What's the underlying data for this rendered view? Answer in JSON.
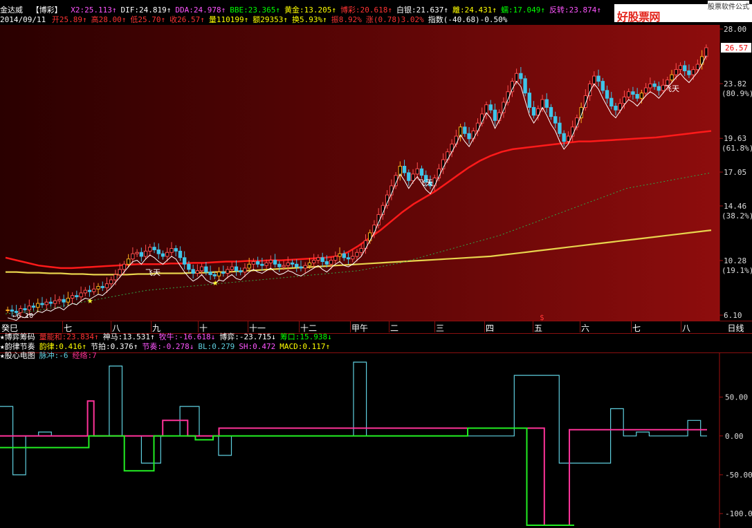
{
  "header": {
    "stock_name": "金达威",
    "indicator_tag": "【博彩】",
    "items": [
      {
        "text": "X2:25.113↑",
        "color": "#ff55ff"
      },
      {
        "text": "DIF:24.819↑",
        "color": "#ffffff"
      },
      {
        "text": "DDA:24.978↑",
        "color": "#ff55ff"
      },
      {
        "text": "BBE:23.365↑",
        "color": "#00ff00"
      },
      {
        "text": "黄金:13.205↑",
        "color": "#ffff00"
      },
      {
        "text": "博彩:20.618↑",
        "color": "#ff3333"
      },
      {
        "text": "白银:21.637↑",
        "color": "#ffffff"
      },
      {
        "text": "離:24.431↑",
        "color": "#ffff00"
      },
      {
        "text": "蠕:17.049↑",
        "color": "#00ff00"
      },
      {
        "text": "反转:23.874↑",
        "color": "#ff55ff"
      }
    ]
  },
  "quote": {
    "date": "2014/09/11",
    "items": [
      {
        "text": "开25.89↑",
        "color": "#ff3333"
      },
      {
        "text": "高28.00↑",
        "color": "#ff3333"
      },
      {
        "text": "低25.70↑",
        "color": "#ff3333"
      },
      {
        "text": "收26.57↑",
        "color": "#ff3333"
      },
      {
        "text": "量110199↑",
        "color": "#ffff00"
      },
      {
        "text": "额29353↑",
        "color": "#ffff00"
      },
      {
        "text": "换5.93%↑",
        "color": "#ffff00"
      },
      {
        "text": "振8.92%",
        "color": "#ff3333"
      },
      {
        "text": "涨(0.78)3.02%",
        "color": "#ff3333"
      },
      {
        "text": "指数(-40.68)-0.50%",
        "color": "#ffffff"
      }
    ]
  },
  "watermark": {
    "text": "好股票网Goodgupiao.com",
    "sub": "股票软件公式"
  },
  "chart_data": [
    {
      "type": "line",
      "name": "candlestick-price",
      "y_ticks": [
        {
          "value": 28.0,
          "label": "28.00"
        },
        {
          "value": 23.82,
          "label": "23.82",
          "pct": "(80.9%)"
        },
        {
          "value": 19.63,
          "label": "19.63",
          "pct": "(61.8%)"
        },
        {
          "value": 17.05,
          "label": "17.05"
        },
        {
          "value": 14.46,
          "label": "14.46",
          "pct": "(38.2%)"
        },
        {
          "value": 10.28,
          "label": "10.28",
          "pct": "(19.1%)"
        },
        {
          "value": 6.1,
          "label": "6.10"
        }
      ],
      "last_price": "26.57",
      "low_label": "6.10",
      "ylim": [
        6.1,
        28.0
      ],
      "annotations": [
        "飞天",
        "飞天",
        "飞天",
        "飞天"
      ],
      "months": [
        "癸巳",
        "七",
        "八",
        "九",
        "十",
        "十一",
        "十二",
        "甲午",
        "二",
        "三",
        "四",
        "五",
        "六",
        "七",
        "八"
      ],
      "month_marker": "$",
      "period": "日线",
      "close_series": [
        6.5,
        6.4,
        6.3,
        6.6,
        6.5,
        6.8,
        6.7,
        7.0,
        6.9,
        7.1,
        7.0,
        7.2,
        7.3,
        7.1,
        7.4,
        7.6,
        7.5,
        7.8,
        8.0,
        7.9,
        8.1,
        8.3,
        8.2,
        8.5,
        8.8,
        9.2,
        9.6,
        10.0,
        10.4,
        10.8,
        10.9,
        10.6,
        11.0,
        11.3,
        11.1,
        10.8,
        10.6,
        10.9,
        11.2,
        11.0,
        10.5,
        10.0,
        9.6,
        9.3,
        9.5,
        9.8,
        9.4,
        9.2,
        9.1,
        9.4,
        9.3,
        9.6,
        9.8,
        9.5,
        9.4,
        9.7,
        10.0,
        10.2,
        10.0,
        9.9,
        10.1,
        10.3,
        10.0,
        9.8,
        9.9,
        10.1,
        10.0,
        9.8,
        9.7,
        9.9,
        10.1,
        10.3,
        10.5,
        10.2,
        10.0,
        10.3,
        10.6,
        10.8,
        10.5,
        10.4,
        10.6,
        10.9,
        11.2,
        11.8,
        12.4,
        13.0,
        13.8,
        14.5,
        15.3,
        16.0,
        16.8,
        17.5,
        17.0,
        16.4,
        16.9,
        17.3,
        16.8,
        16.3,
        16.0,
        16.6,
        17.3,
        18.0,
        18.6,
        19.2,
        19.8,
        20.5,
        20.0,
        19.6,
        20.2,
        20.8,
        21.5,
        22.2,
        21.8,
        21.0,
        21.6,
        22.4,
        23.2,
        24.0,
        24.6,
        24.2,
        23.1,
        22.0,
        21.4,
        21.9,
        22.6,
        22.0,
        21.3,
        20.8,
        20.0,
        19.4,
        19.8,
        20.5,
        21.2,
        22.0,
        22.9,
        23.8,
        24.4,
        24.0,
        23.3,
        22.7,
        22.1,
        21.8,
        22.3,
        22.8,
        23.2,
        23.0,
        22.7,
        23.1,
        23.5,
        23.8,
        23.6,
        23.3,
        23.7,
        24.1,
        24.5,
        24.9,
        25.2,
        24.8,
        24.5,
        24.9,
        25.3,
        25.89,
        26.57
      ],
      "lines": [
        {
          "name": "yellow-ma",
          "color": "#e8d44d",
          "values": [
            9.4,
            9.4,
            9.35,
            9.35,
            9.3,
            9.3,
            9.25,
            9.25,
            9.2,
            9.2,
            9.2,
            9.2,
            9.25,
            9.25,
            9.3,
            9.3,
            9.3,
            9.35,
            9.35,
            9.4,
            9.4,
            9.45,
            9.5,
            9.55,
            9.6,
            9.65,
            9.7,
            9.75,
            9.8,
            9.85,
            9.9,
            9.95,
            10.0,
            10.05,
            10.1,
            10.15,
            10.2,
            10.25,
            10.3,
            10.35,
            10.4,
            10.45,
            10.5,
            10.55,
            10.6,
            10.7,
            10.8,
            10.9,
            11.0,
            11.1,
            11.2,
            11.3,
            11.4,
            11.5,
            11.6,
            11.7,
            11.8,
            11.9,
            12.0,
            12.1,
            12.2,
            12.3,
            12.4,
            12.5,
            12.6
          ]
        },
        {
          "name": "red-ma",
          "color": "#ff1a1a",
          "values": [
            10.5,
            10.3,
            10.1,
            9.9,
            9.8,
            9.7,
            9.7,
            9.75,
            9.8,
            9.85,
            9.9,
            9.95,
            10.0,
            10.0,
            10.0,
            10.05,
            10.05,
            10.1,
            10.1,
            10.15,
            10.2,
            10.2,
            10.25,
            10.25,
            10.3,
            10.3,
            10.35,
            10.4,
            10.45,
            10.5,
            10.6,
            10.9,
            11.4,
            12.0,
            12.6,
            13.3,
            14.0,
            14.6,
            15.1,
            15.6,
            16.2,
            16.8,
            17.4,
            17.9,
            18.3,
            18.6,
            18.8,
            18.9,
            19.0,
            19.1,
            19.2,
            19.3,
            19.4,
            19.4,
            19.45,
            19.5,
            19.55,
            19.6,
            19.65,
            19.7,
            19.8,
            19.9,
            20.0,
            20.1,
            20.2
          ]
        },
        {
          "name": "green-dashed",
          "color": "#2ea84a",
          "dash": true,
          "values": [
            6.2,
            6.3,
            6.4,
            6.6,
            6.8,
            7.0,
            7.2,
            7.4,
            7.6,
            7.8,
            8.0,
            8.1,
            8.2,
            8.3,
            8.4,
            8.5,
            8.6,
            8.7,
            8.8,
            8.9,
            9.0,
            9.1,
            9.2,
            9.3,
            9.4,
            9.5,
            9.7,
            9.9,
            10.1,
            10.4,
            10.7,
            11.0,
            11.3,
            11.6,
            11.9,
            12.2,
            12.6,
            13.0,
            13.4,
            13.8,
            14.2,
            14.6,
            15.0,
            15.4,
            15.8,
            16.0,
            16.2,
            16.4,
            16.6,
            16.8,
            17.0
          ]
        }
      ]
    },
    {
      "type": "line",
      "name": "pulse-indicator",
      "y_ticks": [
        {
          "value": 50,
          "label": "50.00"
        },
        {
          "value": 0,
          "label": "0.00"
        },
        {
          "value": -50,
          "label": "-50.00"
        },
        {
          "value": -100,
          "label": "-100.0"
        }
      ],
      "ylim": [
        -115,
        95
      ],
      "series": [
        {
          "name": "脉冲",
          "color": "#5fd0e0",
          "values": [
            38,
            38,
            -50,
            -50,
            0,
            0,
            5,
            5,
            0,
            0,
            0,
            0,
            0,
            0,
            0,
            0,
            0,
            90,
            90,
            0,
            0,
            0,
            -35,
            -35,
            -35,
            0,
            0,
            0,
            38,
            38,
            38,
            0,
            0,
            0,
            -25,
            -25,
            0,
            0,
            0,
            0,
            0,
            0,
            0,
            0,
            0,
            0,
            0,
            0,
            0,
            0,
            0,
            0,
            0,
            0,
            0,
            95,
            95,
            0,
            0,
            0,
            0,
            0,
            0,
            0,
            0,
            0,
            0,
            0,
            0,
            0,
            0,
            0,
            0,
            0,
            0,
            0,
            0,
            0,
            0,
            0,
            78,
            78,
            78,
            78,
            78,
            78,
            78,
            -35,
            -35,
            -35,
            -35,
            -35,
            -35,
            -35,
            -35,
            35,
            35,
            0,
            0,
            5,
            5,
            0,
            0,
            0,
            0,
            0,
            0,
            20,
            20,
            0,
            0
          ]
        },
        {
          "name": "经络",
          "color": "#ff3399",
          "values": [
            0,
            0,
            0,
            0,
            0,
            0,
            0,
            0,
            0,
            0,
            0,
            0,
            0,
            0,
            45,
            0,
            0,
            0,
            0,
            0,
            0,
            0,
            0,
            0,
            0,
            0,
            20,
            20,
            20,
            20,
            0,
            0,
            0,
            0,
            0,
            10,
            10,
            10,
            10,
            10,
            10,
            10,
            10,
            10,
            10,
            10,
            10,
            10,
            10,
            10,
            10,
            10,
            10,
            10,
            10,
            10,
            10,
            10,
            10,
            10,
            10,
            10,
            10,
            10,
            10,
            10,
            10,
            10,
            10,
            10,
            10,
            10,
            10,
            10,
            10,
            10,
            10,
            10,
            10,
            10,
            10,
            10,
            10,
            10,
            10,
            10,
            10,
            -115,
            -115,
            -115,
            -115,
            8,
            8,
            8,
            8,
            8,
            8,
            8,
            8,
            8,
            8,
            8,
            8,
            8,
            8,
            8,
            8,
            8,
            8,
            8,
            8,
            8,
            8,
            8
          ]
        },
        {
          "name": "base-green",
          "color": "#22ee22",
          "values": [
            -15,
            -15,
            -15,
            -15,
            -15,
            -15,
            -15,
            -15,
            -15,
            -15,
            -15,
            -15,
            -15,
            -15,
            -15,
            0,
            0,
            0,
            0,
            0,
            0,
            -45,
            -45,
            -45,
            -45,
            -45,
            0,
            0,
            0,
            0,
            0,
            0,
            0,
            -5,
            -5,
            -5,
            0,
            0,
            0,
            0,
            0,
            0,
            0,
            0,
            0,
            0,
            0,
            0,
            0,
            0,
            0,
            0,
            0,
            0,
            0,
            0,
            0,
            0,
            0,
            0,
            0,
            0,
            0,
            0,
            0,
            0,
            0,
            0,
            0,
            0,
            0,
            0,
            0,
            0,
            0,
            0,
            0,
            0,
            0,
            10,
            10,
            10,
            10,
            10,
            10,
            10,
            10,
            10,
            10,
            -115,
            -115,
            -115,
            -115,
            -115,
            -115,
            -115,
            -115,
            -115
          ]
        }
      ]
    }
  ],
  "indicators": {
    "row1": [
      {
        "text": "★博弈筹码",
        "color": "#ffffff"
      },
      {
        "text": "量能和:23.834↑",
        "color": "#ff3333"
      },
      {
        "text": "神马:13.531↑",
        "color": "#ffffff"
      },
      {
        "text": "牧牛:-16.618↓",
        "color": "#ff55ff"
      },
      {
        "text": "博弈:-23.715↓",
        "color": "#ffffff"
      },
      {
        "text": "筹口:15.938↓",
        "color": "#00ff00"
      }
    ],
    "row2": [
      {
        "text": "★韵律节奏",
        "color": "#ffffff"
      },
      {
        "text": "韵律:0.416↑",
        "color": "#ffff00"
      },
      {
        "text": "节拍:0.376↑",
        "color": "#ffffff"
      },
      {
        "text": "节奏:-0.278↓",
        "color": "#ff55ff"
      },
      {
        "text": "BL:0.279",
        "color": "#5fd0e0"
      },
      {
        "text": "SH:0.472",
        "color": "#ff55ff"
      },
      {
        "text": "MACD:0.117↑",
        "color": "#ffff00"
      }
    ],
    "row3": [
      {
        "text": "★股心电图",
        "color": "#ffffff"
      },
      {
        "text": "脉冲:-6",
        "color": "#5fd0e0"
      },
      {
        "text": "经络:7",
        "color": "#ff3399"
      }
    ]
  }
}
